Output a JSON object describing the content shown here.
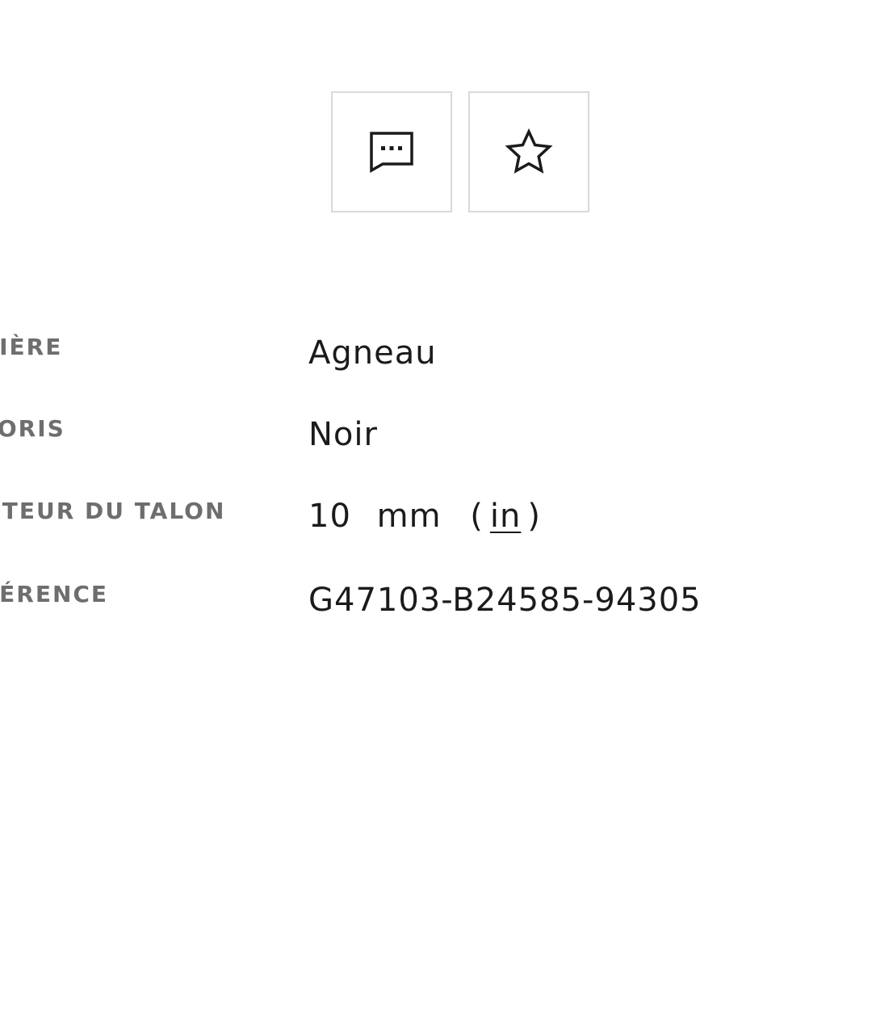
{
  "actions": {
    "contact_icon": "chat-bubble-dots-icon",
    "wishlist_icon": "star-outline-icon"
  },
  "specs": {
    "material": {
      "label": "TIÈRE",
      "value": "Agneau"
    },
    "color": {
      "label": "LORIS",
      "value": "Noir"
    },
    "heel_height": {
      "label": "UTEUR DU TALON",
      "value": "10",
      "unit": "mm",
      "paren_open": "(",
      "alt_unit": "in",
      "paren_close": ")"
    },
    "reference": {
      "label": "FÉRENCE",
      "value": "G47103-B24585-94305"
    }
  },
  "colors": {
    "label": "#6e6e6e",
    "value": "#1b1b1b",
    "button_border": "#d9d9d9"
  }
}
